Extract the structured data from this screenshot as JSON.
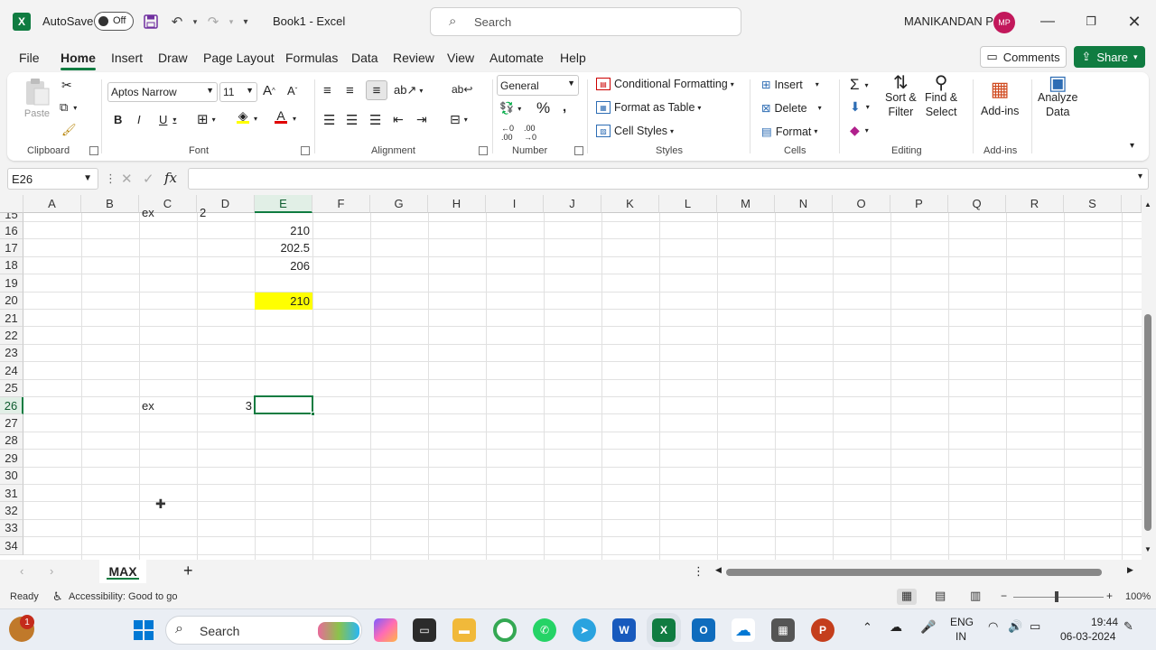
{
  "window": {
    "autosave_label": "AutoSave",
    "autosave_state": "Off",
    "doc_title": "Book1  -  Excel",
    "search_placeholder": "Search",
    "user_name": "MANIKANDAN P",
    "user_initials": "MP"
  },
  "menu": {
    "tabs": [
      "File",
      "Home",
      "Insert",
      "Draw",
      "Page Layout",
      "Formulas",
      "Data",
      "Review",
      "View",
      "Automate",
      "Help"
    ],
    "active": "Home",
    "comments_label": "Comments",
    "share_label": "Share"
  },
  "ribbon": {
    "clipboard": {
      "paste": "Paste",
      "group": "Clipboard"
    },
    "font": {
      "name": "Aptos Narrow",
      "size": "11",
      "group": "Font"
    },
    "alignment": {
      "group": "Alignment"
    },
    "number": {
      "format": "General",
      "group": "Number"
    },
    "styles": {
      "conditional": "Conditional Formatting",
      "table": "Format as Table",
      "cell_styles": "Cell Styles",
      "group": "Styles"
    },
    "cells": {
      "insert": "Insert",
      "delete": "Delete",
      "format": "Format",
      "group": "Cells"
    },
    "editing": {
      "sort1": "Sort &",
      "sort2": "Filter",
      "find1": "Find &",
      "find2": "Select",
      "group": "Editing"
    },
    "addins": {
      "label": "Add-ins",
      "group": "Add-ins"
    },
    "analyze": {
      "line1": "Analyze",
      "line2": "Data"
    }
  },
  "formula_bar": {
    "name_box": "E26",
    "fx": "fx",
    "formula": ""
  },
  "grid": {
    "columns": [
      "A",
      "B",
      "C",
      "D",
      "E",
      "F",
      "G",
      "H",
      "I",
      "J",
      "K",
      "L",
      "M",
      "N",
      "O",
      "P",
      "Q",
      "R",
      "S"
    ],
    "rows": [
      "15",
      "16",
      "17",
      "18",
      "19",
      "20",
      "21",
      "22",
      "23",
      "24",
      "25",
      "26",
      "27",
      "28",
      "29",
      "30",
      "31",
      "32",
      "33",
      "34"
    ],
    "cells": {
      "C15": "ex",
      "D15": "2",
      "E16": "210",
      "E17": "202.5",
      "E18": "206",
      "E20": "210",
      "C26": "ex",
      "D26": "3"
    },
    "highlight_color": "#ffff00",
    "selected_cell": "E26"
  },
  "sheets": {
    "tabs": [
      "MAX"
    ],
    "add_label": "+"
  },
  "status": {
    "ready": "Ready",
    "accessibility": "Accessibility: Good to go",
    "zoom": "100%"
  },
  "taskbar": {
    "search": "Search",
    "lang1": "ENG",
    "lang2": "IN",
    "time": "19:44",
    "date": "06-03-2024",
    "notification_count": "1"
  },
  "colors": {
    "accent": "#107c41",
    "avatar": "#c2185b"
  }
}
